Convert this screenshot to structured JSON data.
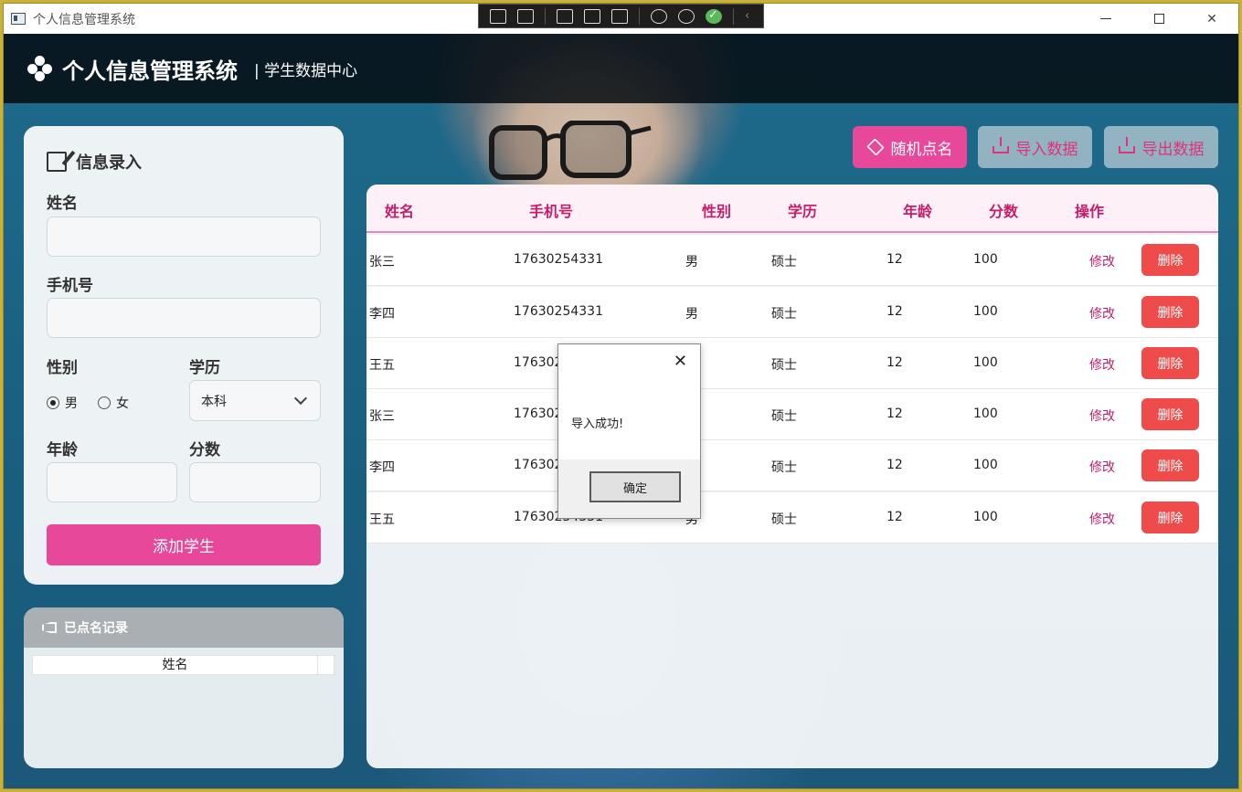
{
  "window": {
    "title": "个人信息管理系统"
  },
  "header": {
    "title": "个人信息管理系统",
    "subtitle": "| 学生数据中心"
  },
  "form": {
    "title": "信息录入",
    "name_label": "姓名",
    "phone_label": "手机号",
    "gender_label": "性别",
    "gender_options": [
      "男",
      "女"
    ],
    "gender_selected": "男",
    "education_label": "学历",
    "education_value": "本科",
    "age_label": "年龄",
    "score_label": "分数",
    "add_button": "添加学生"
  },
  "called_records": {
    "title": "已点名记录",
    "column": "姓名"
  },
  "toolbar": {
    "random_call": "随机点名",
    "import": "导入数据",
    "export": "导出数据"
  },
  "table": {
    "headers": [
      "姓名",
      "手机号",
      "性别",
      "学历",
      "年龄",
      "分数",
      "操作"
    ],
    "rows": [
      {
        "name": "张三",
        "phone": "17630254331",
        "gender": "男",
        "education": "硕士",
        "age": "12",
        "score": "100",
        "edit": "修改",
        "delete": "删除"
      },
      {
        "name": "李四",
        "phone": "17630254331",
        "gender": "男",
        "education": "硕士",
        "age": "12",
        "score": "100",
        "edit": "修改",
        "delete": "删除"
      },
      {
        "name": "王五",
        "phone": "17630254331",
        "gender": "男",
        "education": "硕士",
        "age": "12",
        "score": "100",
        "edit": "修改",
        "delete": "删除"
      },
      {
        "name": "张三",
        "phone": "17630254331",
        "gender": "男",
        "education": "硕士",
        "age": "12",
        "score": "100",
        "edit": "修改",
        "delete": "删除"
      },
      {
        "name": "李四",
        "phone": "17630254331",
        "gender": "男",
        "education": "硕士",
        "age": "12",
        "score": "100",
        "edit": "修改",
        "delete": "删除"
      },
      {
        "name": "王五",
        "phone": "17630254331",
        "gender": "男",
        "education": "硕士",
        "age": "12",
        "score": "100",
        "edit": "修改",
        "delete": "删除"
      }
    ]
  },
  "dialog": {
    "message": "导入成功!",
    "ok_button": "确定"
  },
  "colors": {
    "accent": "#e8489a",
    "header_text": "#c61d6b",
    "delete": "#ef4b4b"
  }
}
